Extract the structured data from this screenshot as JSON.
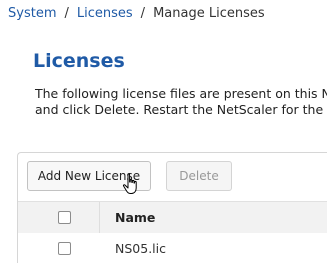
{
  "breadcrumb": {
    "items": [
      {
        "label": "System"
      },
      {
        "label": "Licenses"
      }
    ],
    "separator": "/",
    "current": "Manage Licenses"
  },
  "page": {
    "title": "Licenses",
    "description_line1": "The following license files are present on this NetS",
    "description_line2": "and click Delete. Restart the NetScaler for the licer"
  },
  "toolbar": {
    "add_label": "Add New License",
    "delete_label": "Delete"
  },
  "table": {
    "columns": {
      "name": "Name"
    },
    "rows": [
      {
        "name": "NS05.lic"
      }
    ]
  },
  "colors": {
    "link": "#1f5aa6",
    "title": "#1f5aa6"
  },
  "icons": {
    "cursor": "hand-pointer-icon"
  }
}
